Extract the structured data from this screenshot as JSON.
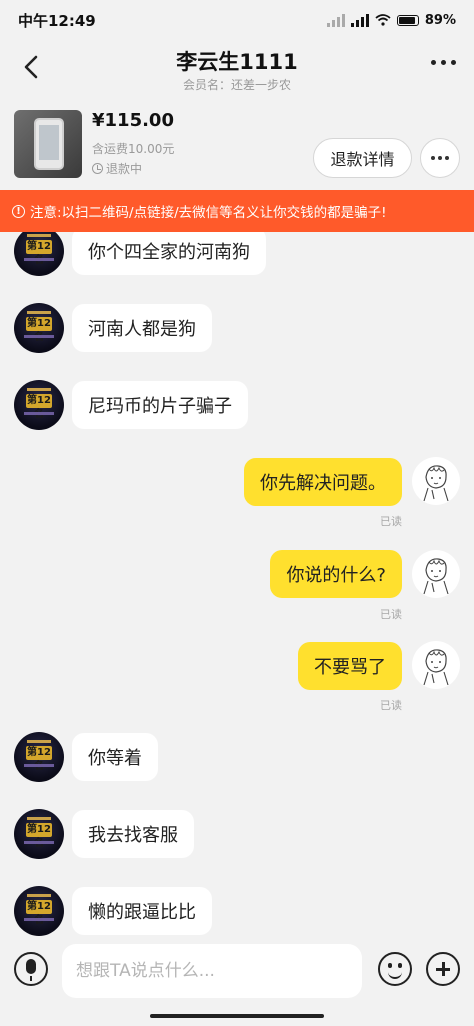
{
  "status_bar": {
    "time": "中午12:49",
    "battery": "89%"
  },
  "header": {
    "title": "李云生1111",
    "member_label": "会员名：还差一步农"
  },
  "product": {
    "price": "¥115.00",
    "shipping": "含运费10.00元",
    "status": "退款中",
    "refund_button": "退款详情"
  },
  "warning": "注意:以扫二维码/点链接/去微信等名义让你交钱的都是骗子!",
  "messages": [
    {
      "side": "left",
      "text": "你个四全家的河南狗"
    },
    {
      "side": "left",
      "text": "河南人都是狗"
    },
    {
      "side": "left",
      "text": "尼玛币的片子骗子"
    },
    {
      "side": "right",
      "text": "你先解决问题。",
      "read": "已读"
    },
    {
      "side": "right",
      "text": "你说的什么?",
      "read": "已读"
    },
    {
      "side": "right",
      "text": "不要骂了",
      "read": "已读"
    },
    {
      "side": "left",
      "text": "你等着"
    },
    {
      "side": "left",
      "text": "我去找客服"
    },
    {
      "side": "left",
      "text": "懒的跟逼比比"
    }
  ],
  "avatar_badge": "第12名",
  "input": {
    "placeholder": "想跟TA说点什么..."
  },
  "icons": {
    "back": "chevron-left-icon",
    "more": "more-horizontal-icon",
    "warning": "info-circle-icon",
    "clock": "clock-icon",
    "mic": "microphone-icon",
    "emoji": "emoji-icon",
    "plus": "plus-circle-icon"
  },
  "colors": {
    "warning_bg": "#ff5a2a",
    "my_bubble": "#ffe02e",
    "page_bg": "#f2f2f2"
  }
}
